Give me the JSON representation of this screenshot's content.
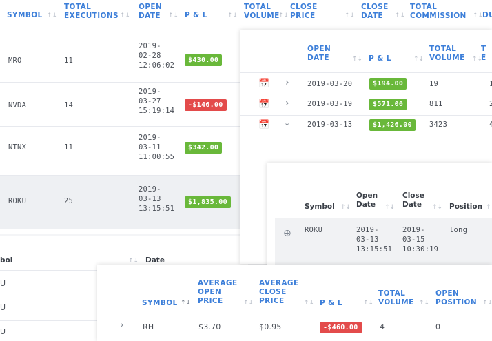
{
  "back_table": {
    "headers": [
      "SYMBOL",
      "TOTAL EXECUTIONS",
      "OPEN DATE",
      "P & L",
      "TOTAL VOLUME",
      "CLOSE PRICE",
      "CLOSE DATE",
      "TOTAL COMMISSION",
      "DU"
    ],
    "rows": [
      {
        "symbol": "MRO",
        "executions": "11",
        "date_l1": "2019-",
        "date_l2": "02-28",
        "date_l3": "12:06:02",
        "pnl": "$430.00",
        "pnl_sign": "pos"
      },
      {
        "symbol": "NVDA",
        "executions": "14",
        "date_l1": "2019-",
        "date_l2": "03-27",
        "date_l3": "15:19:14",
        "pnl": "-$146.00",
        "pnl_sign": "neg"
      },
      {
        "symbol": "NTNX",
        "executions": "11",
        "date_l1": "2019-",
        "date_l2": "03-11",
        "date_l3": "11:00:55",
        "pnl": "$342.00",
        "pnl_sign": "pos"
      },
      {
        "symbol": "ROKU",
        "executions": "25",
        "date_l1": "2019-",
        "date_l2": "03-13",
        "date_l3": "13:15:51",
        "pnl": "$1,835.00",
        "pnl_sign": "pos"
      }
    ]
  },
  "left_sub": {
    "headers": [
      "bol",
      "Date"
    ],
    "rows": [
      "U",
      "U",
      "U"
    ]
  },
  "detail_panel": {
    "headers": [
      "OPEN DATE",
      "P & L",
      "TOTAL VOLUME",
      "T E"
    ],
    "rows": [
      {
        "date": "2019-03-20",
        "pnl": "$194.00",
        "volume": "19",
        "extra": "1"
      },
      {
        "date": "2019-03-19",
        "pnl": "$571.00",
        "volume": "811",
        "extra": "2"
      },
      {
        "date": "2019-03-13",
        "pnl": "$1,426.00",
        "volume": "3423",
        "extra": "4"
      }
    ]
  },
  "inner_panel": {
    "headers": [
      "Symbol",
      "Open Date",
      "Close Date",
      "Position"
    ],
    "row": {
      "symbol": "ROKU",
      "open_l1": "2019-",
      "open_l2": "03-13",
      "open_l3": "13:15:51",
      "close_l1": "2019-",
      "close_l2": "03-15",
      "close_l3": "10:30:19",
      "position": "long"
    }
  },
  "bottom_panel": {
    "headers": [
      "SYMBOL",
      "AVERAGE OPEN PRICE",
      "AVERAGE CLOSE PRICE",
      "P & L",
      "TOTAL VOLUME",
      "OPEN POSITION"
    ],
    "row": {
      "symbol": "RH",
      "avg_open": "$3.70",
      "avg_close": "$0.95",
      "pnl": "-$460.00",
      "volume": "4",
      "open_pos": "0"
    }
  },
  "colors": {
    "accent": "#3d7fd9",
    "positive": "#69b83a",
    "negative": "#e34b4b"
  }
}
